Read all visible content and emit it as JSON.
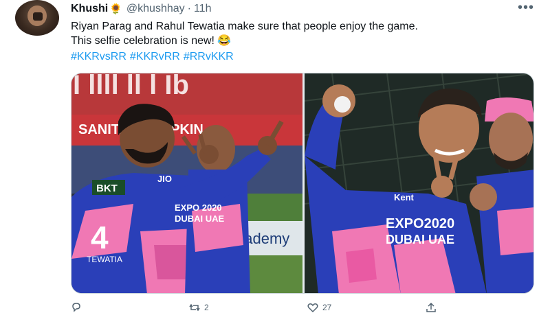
{
  "tweet": {
    "display_name": "Khushi",
    "name_emoji": "🌻",
    "handle": "@khushhay",
    "separator": "·",
    "time": "11h",
    "more_icon": "more-horizontal-icon",
    "text_line1": "Riyan Parag and Rahul Tewatia make sure that people enjoy the game.",
    "text_line2": "This selfie celebration is new! 😂",
    "hashtags": [
      "#KKRvsRR",
      "#KKRvRR",
      "#RRvKKR"
    ]
  },
  "media": {
    "left_photo": {
      "banner_text": "SANITARY NAPKIN",
      "jersey_number": "4",
      "jersey_name": "TEWATIA",
      "sponsor": "JIO",
      "badge": "BKT",
      "expo": "EXPO 2020 DUBAI UAE",
      "board_text": "academy"
    },
    "right_photo": {
      "expo": "EXPO2020 DUBAI UAE",
      "chest": "Kent"
    }
  },
  "actions": [
    {
      "icon": "reply-icon",
      "count": ""
    },
    {
      "icon": "retweet-icon",
      "count": "2"
    },
    {
      "icon": "like-icon",
      "count": "27"
    },
    {
      "icon": "share-icon",
      "count": ""
    }
  ],
  "colors": {
    "link": "#1d9bf0",
    "secondary": "#536471",
    "jersey_pink": "#f078b4",
    "jersey_blue": "#2a3fb8"
  }
}
